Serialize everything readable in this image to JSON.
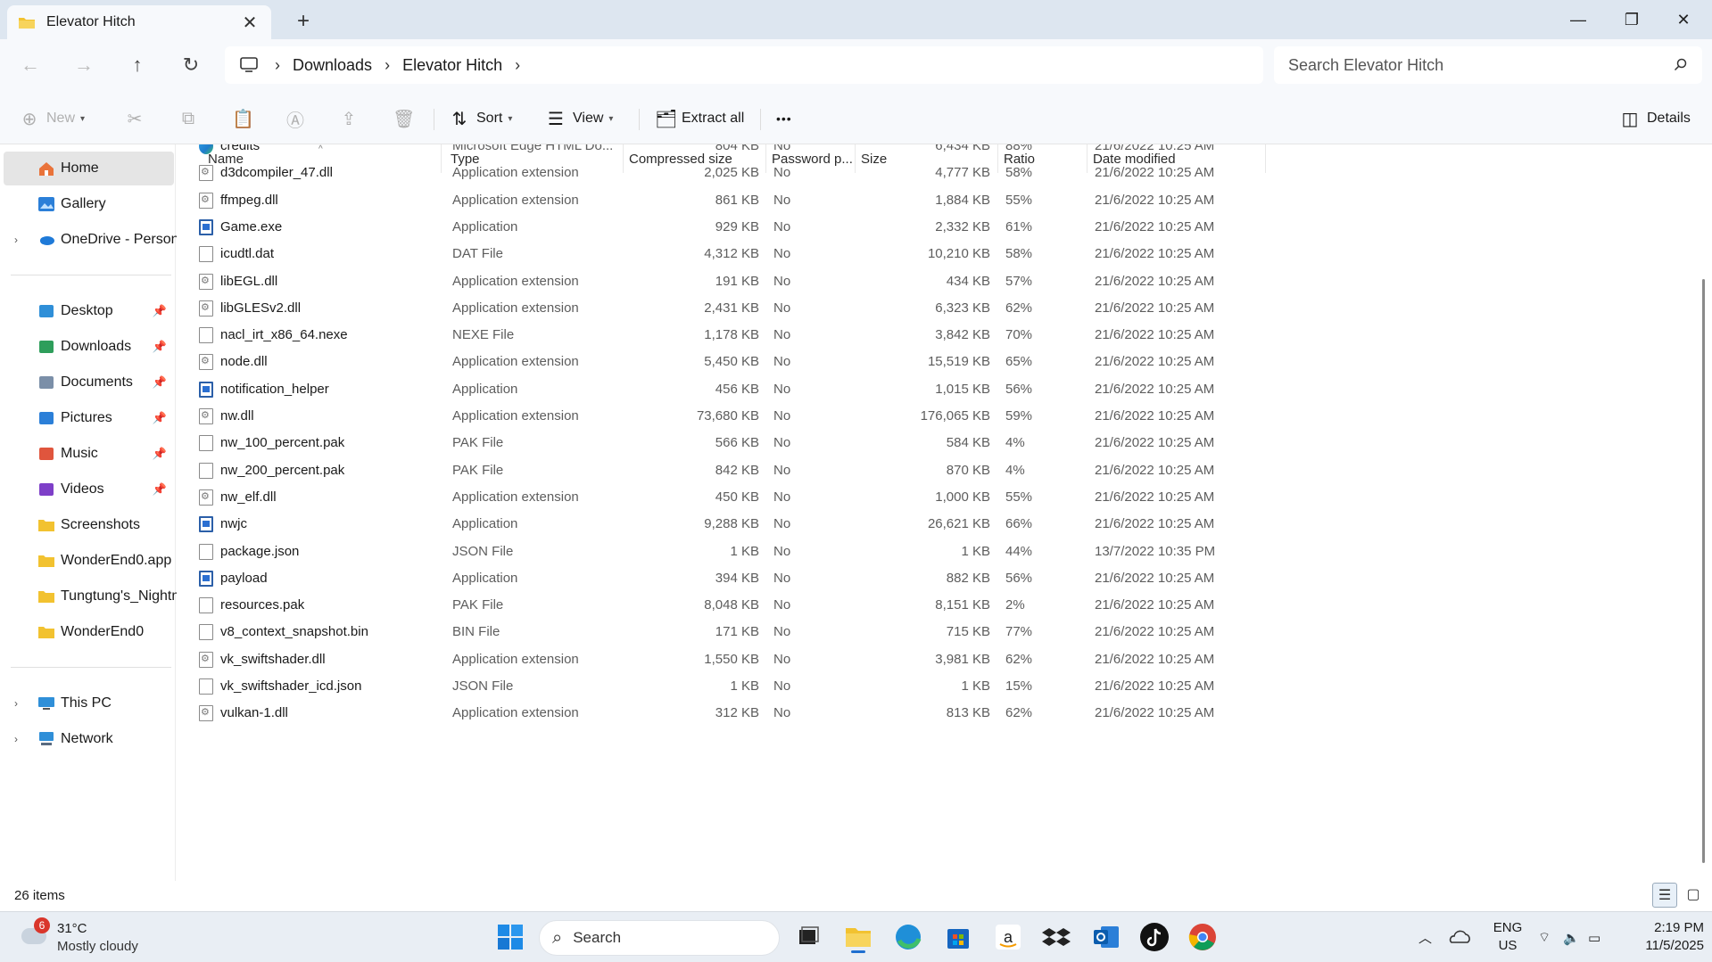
{
  "window": {
    "tab_title": "Elevator Hitch",
    "newtab_glyph": "+",
    "close_glyph": "✕",
    "minimize_glyph": "—",
    "restore_glyph": "❐",
    "winclose_glyph": "✕"
  },
  "address": {
    "back_glyph": "←",
    "forward_glyph": "→",
    "up_glyph": "↑",
    "refresh_glyph": "↻",
    "crumbs": [
      "Downloads",
      "Elevator Hitch"
    ],
    "separator": "›",
    "search_placeholder": "Search Elevator Hitch"
  },
  "commands": {
    "new_label": "New",
    "sort_label": "Sort",
    "view_label": "View",
    "extract_label": "Extract all",
    "more_glyph": "•••",
    "details_label": "Details"
  },
  "sidebar": {
    "home": "Home",
    "gallery": "Gallery",
    "onedrive": "OneDrive - Persona",
    "pinned": [
      {
        "label": "Desktop",
        "icon": "desktop-icon",
        "color": "#2f8fd8"
      },
      {
        "label": "Downloads",
        "icon": "download-icon",
        "color": "#2e9e5b"
      },
      {
        "label": "Documents",
        "icon": "document-icon",
        "color": "#7b8fa8"
      },
      {
        "label": "Pictures",
        "icon": "pictures-icon",
        "color": "#2b7fd8"
      },
      {
        "label": "Music",
        "icon": "music-icon",
        "color": "#e0553d"
      },
      {
        "label": "Videos",
        "icon": "video-icon",
        "color": "#7e3fc8"
      },
      {
        "label": "Screenshots",
        "icon": "folder-icon",
        "color": "#f2c230"
      },
      {
        "label": "WonderEnd0.app",
        "icon": "folder-icon",
        "color": "#f2c230"
      },
      {
        "label": "Tungtung's_Nightm",
        "icon": "folder-icon",
        "color": "#f2c230"
      },
      {
        "label": "WonderEnd0",
        "icon": "folder-icon",
        "color": "#f2c230"
      }
    ],
    "thispc": "This PC",
    "network": "Network"
  },
  "columns": {
    "name": "Name",
    "type": "Type",
    "compressed": "Compressed size",
    "password": "Password p...",
    "size": "Size",
    "ratio": "Ratio",
    "date": "Date modified"
  },
  "files": [
    {
      "name": "credits",
      "icon": "edge",
      "type": "Microsoft Edge HTML Do...",
      "compressed": "804 KB",
      "password": "No",
      "size": "6,434 KB",
      "ratio": "88%",
      "date": "21/6/2022 10:25 AM"
    },
    {
      "name": "d3dcompiler_47.dll",
      "icon": "dll",
      "type": "Application extension",
      "compressed": "2,025 KB",
      "password": "No",
      "size": "4,777 KB",
      "ratio": "58%",
      "date": "21/6/2022 10:25 AM"
    },
    {
      "name": "ffmpeg.dll",
      "icon": "dll",
      "type": "Application extension",
      "compressed": "861 KB",
      "password": "No",
      "size": "1,884 KB",
      "ratio": "55%",
      "date": "21/6/2022 10:25 AM"
    },
    {
      "name": "Game.exe",
      "icon": "app",
      "type": "Application",
      "compressed": "929 KB",
      "password": "No",
      "size": "2,332 KB",
      "ratio": "61%",
      "date": "21/6/2022 10:25 AM"
    },
    {
      "name": "icudtl.dat",
      "icon": "file",
      "type": "DAT File",
      "compressed": "4,312 KB",
      "password": "No",
      "size": "10,210 KB",
      "ratio": "58%",
      "date": "21/6/2022 10:25 AM"
    },
    {
      "name": "libEGL.dll",
      "icon": "dll",
      "type": "Application extension",
      "compressed": "191 KB",
      "password": "No",
      "size": "434 KB",
      "ratio": "57%",
      "date": "21/6/2022 10:25 AM"
    },
    {
      "name": "libGLESv2.dll",
      "icon": "dll",
      "type": "Application extension",
      "compressed": "2,431 KB",
      "password": "No",
      "size": "6,323 KB",
      "ratio": "62%",
      "date": "21/6/2022 10:25 AM"
    },
    {
      "name": "nacl_irt_x86_64.nexe",
      "icon": "file",
      "type": "NEXE File",
      "compressed": "1,178 KB",
      "password": "No",
      "size": "3,842 KB",
      "ratio": "70%",
      "date": "21/6/2022 10:25 AM"
    },
    {
      "name": "node.dll",
      "icon": "dll",
      "type": "Application extension",
      "compressed": "5,450 KB",
      "password": "No",
      "size": "15,519 KB",
      "ratio": "65%",
      "date": "21/6/2022 10:25 AM"
    },
    {
      "name": "notification_helper",
      "icon": "app",
      "type": "Application",
      "compressed": "456 KB",
      "password": "No",
      "size": "1,015 KB",
      "ratio": "56%",
      "date": "21/6/2022 10:25 AM"
    },
    {
      "name": "nw.dll",
      "icon": "dll",
      "type": "Application extension",
      "compressed": "73,680 KB",
      "password": "No",
      "size": "176,065 KB",
      "ratio": "59%",
      "date": "21/6/2022 10:25 AM"
    },
    {
      "name": "nw_100_percent.pak",
      "icon": "file",
      "type": "PAK File",
      "compressed": "566 KB",
      "password": "No",
      "size": "584 KB",
      "ratio": "4%",
      "date": "21/6/2022 10:25 AM"
    },
    {
      "name": "nw_200_percent.pak",
      "icon": "file",
      "type": "PAK File",
      "compressed": "842 KB",
      "password": "No",
      "size": "870 KB",
      "ratio": "4%",
      "date": "21/6/2022 10:25 AM"
    },
    {
      "name": "nw_elf.dll",
      "icon": "dll",
      "type": "Application extension",
      "compressed": "450 KB",
      "password": "No",
      "size": "1,000 KB",
      "ratio": "55%",
      "date": "21/6/2022 10:25 AM"
    },
    {
      "name": "nwjc",
      "icon": "app",
      "type": "Application",
      "compressed": "9,288 KB",
      "password": "No",
      "size": "26,621 KB",
      "ratio": "66%",
      "date": "21/6/2022 10:25 AM"
    },
    {
      "name": "package.json",
      "icon": "file",
      "type": "JSON File",
      "compressed": "1 KB",
      "password": "No",
      "size": "1 KB",
      "ratio": "44%",
      "date": "13/7/2022 10:35 PM"
    },
    {
      "name": "payload",
      "icon": "app",
      "type": "Application",
      "compressed": "394 KB",
      "password": "No",
      "size": "882 KB",
      "ratio": "56%",
      "date": "21/6/2022 10:25 AM"
    },
    {
      "name": "resources.pak",
      "icon": "file",
      "type": "PAK File",
      "compressed": "8,048 KB",
      "password": "No",
      "size": "8,151 KB",
      "ratio": "2%",
      "date": "21/6/2022 10:25 AM"
    },
    {
      "name": "v8_context_snapshot.bin",
      "icon": "file",
      "type": "BIN File",
      "compressed": "171 KB",
      "password": "No",
      "size": "715 KB",
      "ratio": "77%",
      "date": "21/6/2022 10:25 AM"
    },
    {
      "name": "vk_swiftshader.dll",
      "icon": "dll",
      "type": "Application extension",
      "compressed": "1,550 KB",
      "password": "No",
      "size": "3,981 KB",
      "ratio": "62%",
      "date": "21/6/2022 10:25 AM"
    },
    {
      "name": "vk_swiftshader_icd.json",
      "icon": "file",
      "type": "JSON File",
      "compressed": "1 KB",
      "password": "No",
      "size": "1 KB",
      "ratio": "15%",
      "date": "21/6/2022 10:25 AM"
    },
    {
      "name": "vulkan-1.dll",
      "icon": "dll",
      "type": "Application extension",
      "compressed": "312 KB",
      "password": "No",
      "size": "813 KB",
      "ratio": "62%",
      "date": "21/6/2022 10:25 AM"
    }
  ],
  "status": {
    "item_count": "26 items"
  },
  "taskbar": {
    "weather_badge": "6",
    "temperature": "31°C",
    "condition": "Mostly cloudy",
    "search_label": "Search",
    "lang_top": "ENG",
    "lang_bottom": "US",
    "time": "2:19 PM",
    "date": "11/5/2025"
  }
}
